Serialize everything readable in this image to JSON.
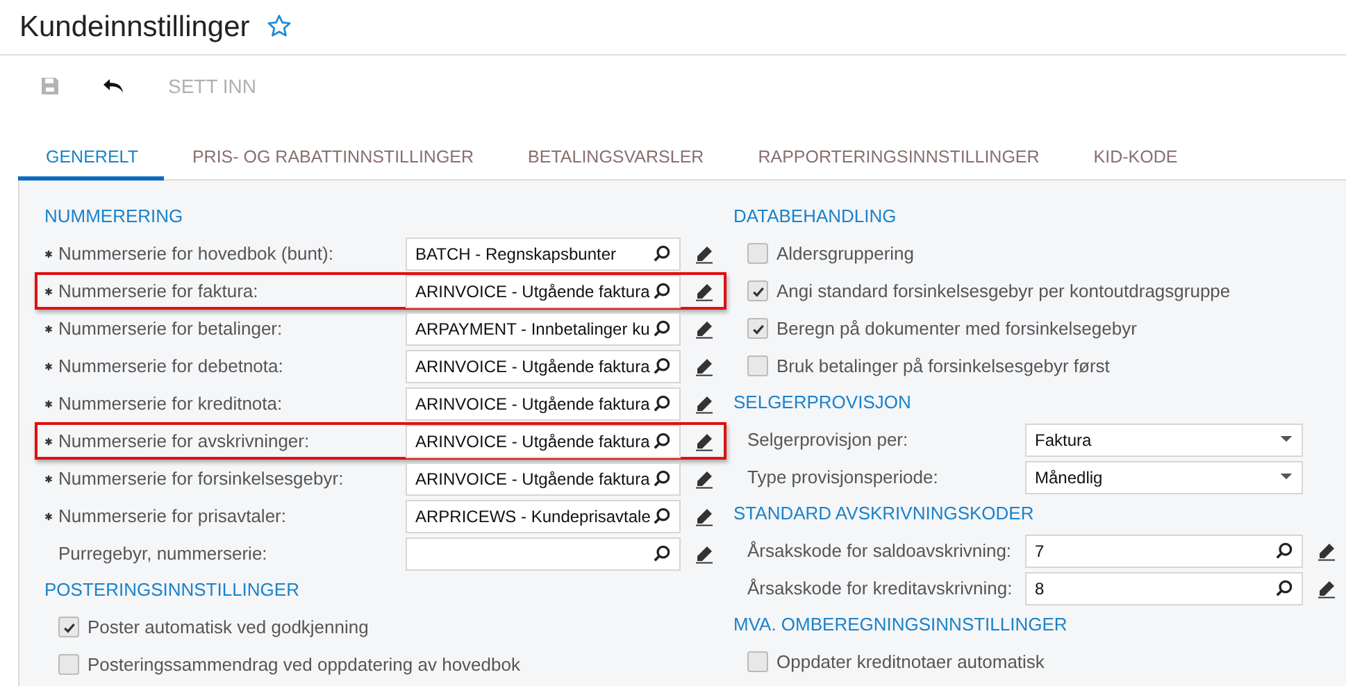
{
  "page": {
    "title": "Kundeinnstillinger",
    "favorite": false
  },
  "toolbar": [
    {
      "kind": "save",
      "disabled": true
    },
    {
      "kind": "undo",
      "disabled": false
    },
    {
      "kind": "text",
      "label": "SETT INN",
      "disabled": true
    }
  ],
  "tabs": [
    {
      "label": "GENERELT",
      "selected": true
    },
    {
      "label": "PRIS- OG RABATTINNSTILLINGER",
      "selected": false
    },
    {
      "label": "BETALINGSVARSLER",
      "selected": false
    },
    {
      "label": "RAPPORTERINGSINNSTILLINGER",
      "selected": false
    },
    {
      "label": "KID-KODE",
      "selected": false
    }
  ],
  "left_column": [
    {
      "heading": "NUMMERERING",
      "rows": [
        {
          "kind": "lookup",
          "label": "Nummerserie for hovedbok (bunt):",
          "required": true,
          "value": "BATCH - Regnskapsbunter",
          "highlighted": false
        },
        {
          "kind": "lookup",
          "label": "Nummerserie for faktura:",
          "required": true,
          "value": "ARINVOICE - Utgående faktura",
          "highlighted": true
        },
        {
          "kind": "lookup",
          "label": "Nummerserie for betalinger:",
          "required": true,
          "value": "ARPAYMENT - Innbetalinger ku",
          "highlighted": false
        },
        {
          "kind": "lookup",
          "label": "Nummerserie for debetnota:",
          "required": true,
          "value": "ARINVOICE - Utgående faktura",
          "highlighted": false
        },
        {
          "kind": "lookup",
          "label": "Nummerserie for kreditnota:",
          "required": true,
          "value": "ARINVOICE - Utgående faktura",
          "highlighted": false
        },
        {
          "kind": "lookup",
          "label": "Nummerserie for avskrivninger:",
          "required": true,
          "value": "ARINVOICE - Utgående faktura",
          "highlighted": true
        },
        {
          "kind": "lookup",
          "label": "Nummerserie for forsinkelsesgebyr:",
          "required": true,
          "value": "ARINVOICE - Utgående faktura",
          "highlighted": false
        },
        {
          "kind": "lookup",
          "label": "Nummerserie for prisavtaler:",
          "required": true,
          "value": "ARPRICEWS - Kundeprisavtale",
          "highlighted": false
        },
        {
          "kind": "lookup",
          "label": "Purregebyr, nummerserie:",
          "required": false,
          "highlighted": false
        }
      ]
    },
    {
      "heading": "POSTERINGSINNSTILLINGER",
      "rows": [
        {
          "kind": "checkbox",
          "label": "Poster automatisk ved godkjenning",
          "checked": true
        },
        {
          "kind": "checkbox",
          "label": "Posteringssammendrag ved oppdatering av hovedbok",
          "checked": false
        }
      ]
    }
  ],
  "right_column": [
    {
      "heading": "DATABEHANDLING",
      "rows": [
        {
          "kind": "checkbox",
          "label": "Aldersgruppering",
          "checked": false
        },
        {
          "kind": "checkbox",
          "label": "Angi standard forsinkelsesgebyr per kontoutdragsgruppe",
          "checked": true
        },
        {
          "kind": "checkbox",
          "label": "Beregn på dokumenter med forsinkelsegebyr",
          "checked": true
        },
        {
          "kind": "checkbox",
          "label": "Bruk betalinger på forsinkelsesgebyr først",
          "checked": false
        }
      ]
    },
    {
      "heading": "SELGERPROVISJON",
      "rows": [
        {
          "kind": "select",
          "label": "Selgerprovisjon per:",
          "value": "Faktura"
        },
        {
          "kind": "select",
          "label": "Type provisjonsperiode:",
          "value": "Månedlig"
        }
      ]
    },
    {
      "heading": "STANDARD AVSKRIVNINGSKODER",
      "rows": [
        {
          "kind": "lookup",
          "label": "Årsakskode for saldoavskrivning:",
          "value": "7"
        },
        {
          "kind": "lookup",
          "label": "Årsakskode for kreditavskrivning:",
          "value": "8"
        }
      ]
    },
    {
      "heading": "MVA. OMBEREGNINGSINNSTILLINGER",
      "rows": [
        {
          "kind": "checkbox",
          "label": "Oppdater kreditnotaer automatisk",
          "checked": false
        }
      ]
    }
  ]
}
